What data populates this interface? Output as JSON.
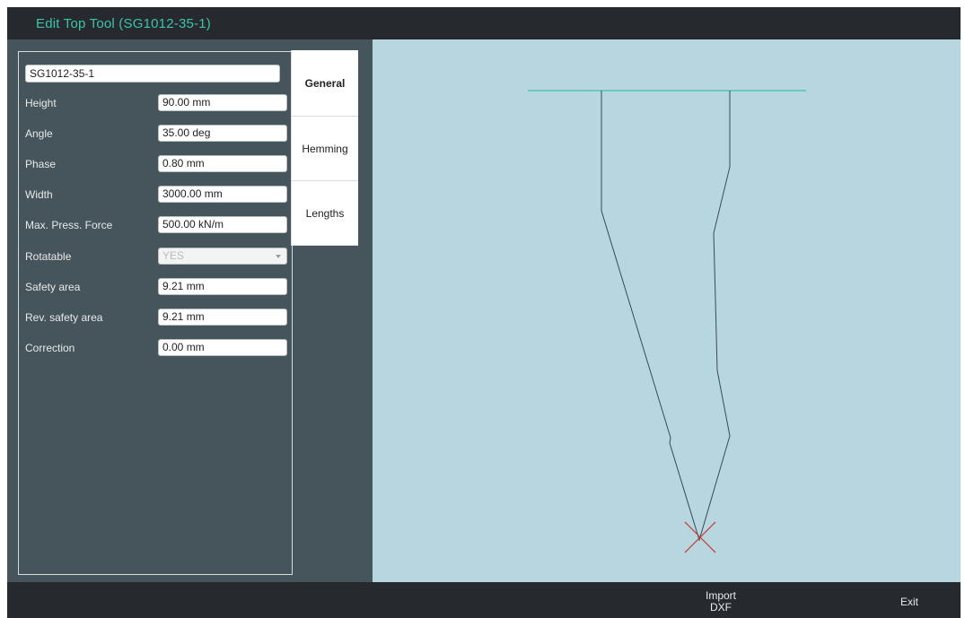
{
  "window": {
    "title": "Edit Top Tool (SG1012-35-1)"
  },
  "form": {
    "tool_name": "SG1012-35-1",
    "fields": [
      {
        "label": "Height",
        "value": "90.00 mm"
      },
      {
        "label": "Angle",
        "value": "35.00 deg"
      },
      {
        "label": "Phase",
        "value": "0.80 mm"
      },
      {
        "label": "Width",
        "value": "3000.00 mm"
      },
      {
        "label": "Max. Press. Force",
        "value": "500.00 kN/m"
      },
      {
        "label": "Rotatable",
        "value": "YES",
        "type": "select",
        "disabled": true
      },
      {
        "label": "Safety area",
        "value": "9.21 mm"
      },
      {
        "label": "Rev. safety area",
        "value": "9.21 mm"
      },
      {
        "label": "Correction",
        "value": "0.00 mm"
      }
    ]
  },
  "tabs": [
    {
      "label": "General",
      "active": true
    },
    {
      "label": "Hemming",
      "active": false
    },
    {
      "label": "Lengths",
      "active": false
    }
  ],
  "toolbar": {
    "import_line1": "Import",
    "import_line2": "DXF",
    "exit_label": "Exit"
  },
  "colors": {
    "title_accent": "#3cc4aa",
    "canvas_background": "#b7d6e0",
    "reference_line": "#3cc4aa",
    "tip_marker": "#c0392b"
  }
}
